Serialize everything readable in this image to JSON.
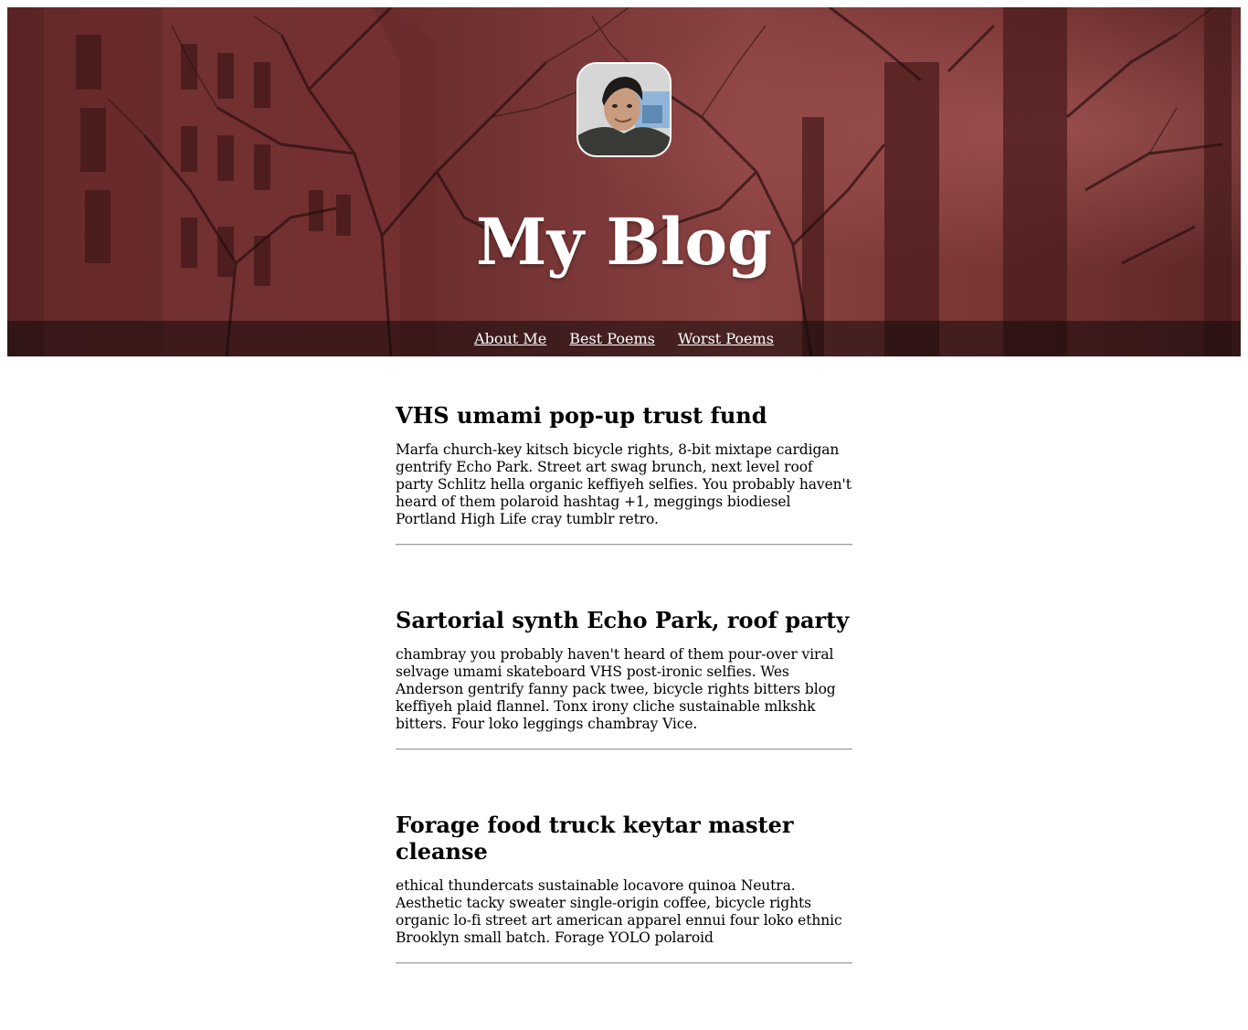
{
  "header": {
    "title": "My Blog",
    "avatar_icon": "profile-photo"
  },
  "nav": {
    "items": [
      {
        "label": "About Me"
      },
      {
        "label": "Best Poems"
      },
      {
        "label": "Worst Poems"
      }
    ]
  },
  "posts": [
    {
      "title": "VHS umami pop-up trust fund",
      "body": "Marfa church-key kitsch bicycle rights, 8-bit mixtape cardigan gentrify Echo Park. Street art swag brunch, next level roof party Schlitz hella organic keffiyeh selfies. You probably haven't heard of them polaroid hashtag +1, meggings biodiesel Portland High Life cray tumblr retro."
    },
    {
      "title": "Sartorial synth Echo Park, roof party",
      "body": "chambray you probably haven't heard of them pour-over viral selvage umami skateboard VHS post-ironic selfies. Wes Anderson gentrify fanny pack twee, bicycle rights bitters blog keffiyeh plaid flannel. Tonx irony cliche sustainable mlkshk bitters. Four loko leggings chambray Vice."
    },
    {
      "title": "Forage food truck keytar master cleanse",
      "body": "ethical thundercats sustainable locavore quinoa Neutra. Aesthetic tacky sweater single-origin coffee, bicycle rights organic lo-fi street art american apparel ennui four loko ethnic Brooklyn small batch. Forage YOLO polaroid"
    }
  ],
  "colors": {
    "hero_tint": "#7a3333",
    "nav_bar": "#1a0f0f",
    "text": "#000000",
    "link": "#ffffff"
  }
}
